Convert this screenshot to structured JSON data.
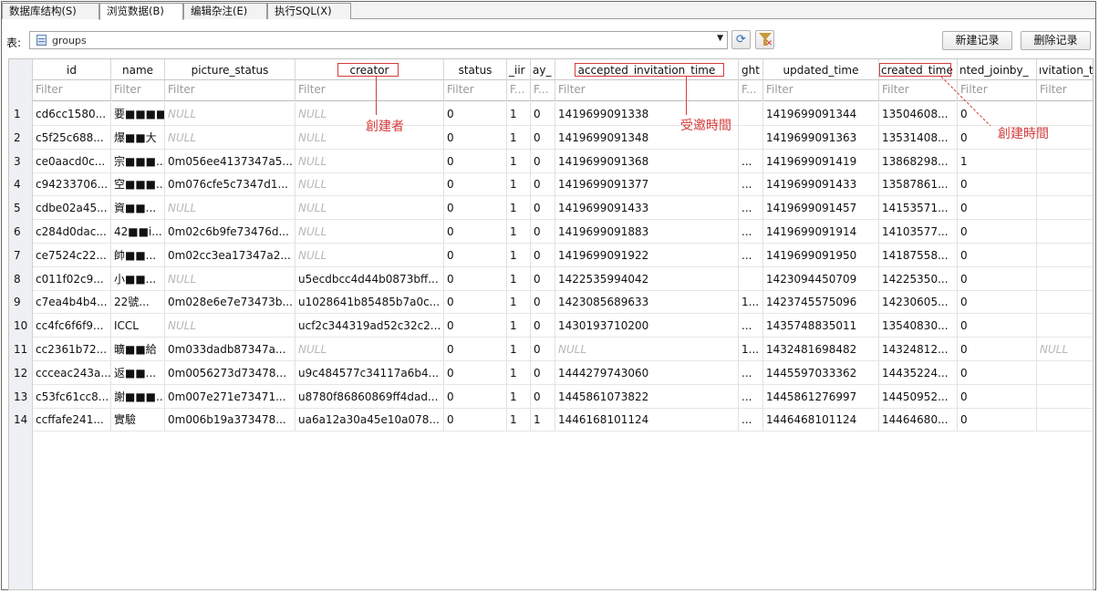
{
  "tabs": [
    {
      "label": "数据库结构(S)",
      "active": false
    },
    {
      "label": "浏览数据(B)",
      "active": true
    },
    {
      "label": "编辑杂注(E)",
      "active": false
    },
    {
      "label": "执行SQL(X)",
      "active": false
    }
  ],
  "toolbar": {
    "table_label": "表:",
    "table_value": "groups",
    "new_record_label": "新建记录",
    "delete_record_label": "删除记录",
    "refresh_icon": "refresh-icon",
    "clear_filter_icon": "clear-filter-icon"
  },
  "grid": {
    "columns": [
      "id",
      "name",
      "picture_status",
      "creator",
      "status",
      "_iir",
      "ay_",
      "accepted_invitation_time",
      "ght",
      "updated_time",
      "created_time",
      "nted_joinby_",
      "ıvitation_t"
    ],
    "filter_placeholders": [
      "Filter",
      "Filter",
      "Filter",
      "Filter",
      "Filter",
      "F...",
      "F...",
      "Filter",
      "F...",
      "Filter",
      "Filter",
      "Filter",
      "Filter"
    ],
    "rows": [
      {
        "num": "1",
        "cells": [
          "cd6cc1580...",
          "要■■■■",
          "NULL",
          "NULL",
          "0",
          "1",
          "0",
          "1419699091338",
          "",
          "1419699091344",
          "13504608...",
          "0",
          ""
        ]
      },
      {
        "num": "2",
        "cells": [
          "c5f25c688...",
          "爆■■大",
          "NULL",
          "NULL",
          "0",
          "1",
          "0",
          "1419699091348",
          "",
          "1419699091363",
          "13531408...",
          "0",
          ""
        ]
      },
      {
        "num": "3",
        "cells": [
          "ce0aacd0c...",
          "宗■■■...",
          "0m056ee4137347a5...",
          "NULL",
          "0",
          "1",
          "0",
          "1419699091368",
          "...",
          "1419699091419",
          "13868298...",
          "1",
          ""
        ]
      },
      {
        "num": "4",
        "cells": [
          "c94233706...",
          "空■■■...",
          "0m076cfe5c7347d1...",
          "NULL",
          "0",
          "1",
          "0",
          "1419699091377",
          "...",
          "1419699091433",
          "13587861...",
          "0",
          ""
        ]
      },
      {
        "num": "5",
        "cells": [
          "cdbe02a45...",
          "資■■...",
          "NULL",
          "NULL",
          "0",
          "1",
          "0",
          "1419699091433",
          "...",
          "1419699091457",
          "14153571...",
          "0",
          ""
        ]
      },
      {
        "num": "6",
        "cells": [
          "c284d0dac...",
          "42■■i...",
          "0m02c6b9fe73476d...",
          "NULL",
          "0",
          "1",
          "0",
          "1419699091883",
          "...",
          "1419699091914",
          "14103577...",
          "0",
          ""
        ]
      },
      {
        "num": "7",
        "cells": [
          "ce7524c22...",
          "帥■■...",
          "0m02cc3ea17347a2...",
          "NULL",
          "0",
          "1",
          "0",
          "1419699091922",
          "...",
          "1419699091950",
          "14187558...",
          "0",
          ""
        ]
      },
      {
        "num": "8",
        "cells": [
          "c011f02c9...",
          "小■■...",
          "NULL",
          "u5ecdbcc4d44b0873bff...",
          "0",
          "1",
          "0",
          "1422535994042",
          "",
          "1423094450709",
          "14225350...",
          "0",
          ""
        ]
      },
      {
        "num": "9",
        "cells": [
          "c7ea4b4b4...",
          "22號...",
          "0m028e6e7e73473b...",
          "u1028641b85485b7a0c...",
          "0",
          "1",
          "0",
          "1423085689633",
          "1...",
          "1423745575096",
          "14230605...",
          "0",
          ""
        ]
      },
      {
        "num": "10",
        "cells": [
          "cc4fc6f6f9...",
          "ICCL",
          "NULL",
          "ucf2c344319ad52c32c2...",
          "0",
          "1",
          "0",
          "1430193710200",
          "...",
          "1435748835011",
          "13540830...",
          "0",
          ""
        ]
      },
      {
        "num": "11",
        "cells": [
          "cc2361b72...",
          "曠■■給",
          "0m033dadb87347a...",
          "NULL",
          "0",
          "1",
          "0",
          "NULL",
          "1...",
          "1432481698482",
          "14324812...",
          "0",
          "NULL"
        ]
      },
      {
        "num": "12",
        "cells": [
          "ccceac243a...",
          "返■■...",
          "0m0056273d73478...",
          "u9c484577c34117a6b4...",
          "0",
          "1",
          "0",
          "1444279743060",
          "...",
          "1445597033362",
          "14435224...",
          "0",
          ""
        ]
      },
      {
        "num": "13",
        "cells": [
          "c53fc61cc8...",
          "謝■■■...",
          "0m007e271e73471...",
          "u8780f86860869ff4dad...",
          "0",
          "1",
          "0",
          "1445861073822",
          "...",
          "1445861276997",
          "14450952...",
          "0",
          ""
        ]
      },
      {
        "num": "14",
        "cells": [
          "ccffafe241...",
          "實驗",
          "0m006b19a373478...",
          "ua6a12a30a45e10a078...",
          "0",
          "1",
          "1",
          "1446168101124",
          "...",
          "1446468101124",
          "14464680...",
          "0",
          ""
        ]
      }
    ]
  },
  "annotations": {
    "creator": "創建者",
    "accepted_invitation_time": "受邀時間",
    "created_time": "創建時間",
    "color": "#d43c3c"
  }
}
